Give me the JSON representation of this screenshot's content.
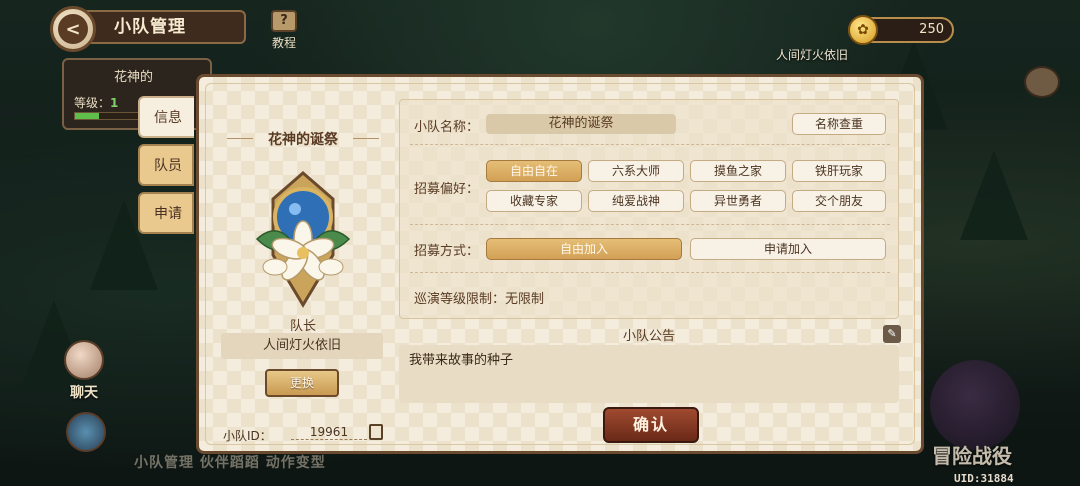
{
  "header": {
    "title": "小队管理",
    "tutorial_label": "教程",
    "tutorial_glyph": "?",
    "coins": "250",
    "coin_glyph": "✿"
  },
  "scene": {
    "npc_name": "人间灯火依旧",
    "bottom_menu": "小队管理  伙伴蹈蹈  动作变型",
    "campaign": "冒险战役",
    "uid": "UID:31884"
  },
  "bg_card": {
    "name": "花神的",
    "level_label": "等级：",
    "level_value": "1"
  },
  "side_icons": {
    "chat": "聊天"
  },
  "tabs": [
    {
      "label": "信息"
    },
    {
      "label": "队员"
    },
    {
      "label": "申请"
    }
  ],
  "team": {
    "name": "花神的诞祭",
    "leader_label": "队长",
    "leader_name": "人间灯火依旧",
    "swap_label": "更换",
    "id_label": "小队ID：",
    "id_value": "19961"
  },
  "form": {
    "name_label": "小队名称：",
    "name_value": "花神的诞祭",
    "rename_label": "名称查重",
    "pref_label": "招募偏好：",
    "prefs": [
      "自由自在",
      "六系大师",
      "摸鱼之家",
      "铁肝玩家",
      "收藏专家",
      "纯爱战神",
      "异世勇者",
      "交个朋友"
    ],
    "method_label": "招募方式：",
    "methods": [
      "自由加入",
      "申请加入"
    ],
    "level_limit": "巡演等级限制：无限制"
  },
  "notice": {
    "title": "小队公告",
    "text": "我带来故事的种子",
    "edit_glyph": "✎"
  },
  "confirm_label": "确认",
  "colors": {
    "accent": "#d2a055",
    "confirm": "#7a3220",
    "panel": "#f4ecdc"
  }
}
